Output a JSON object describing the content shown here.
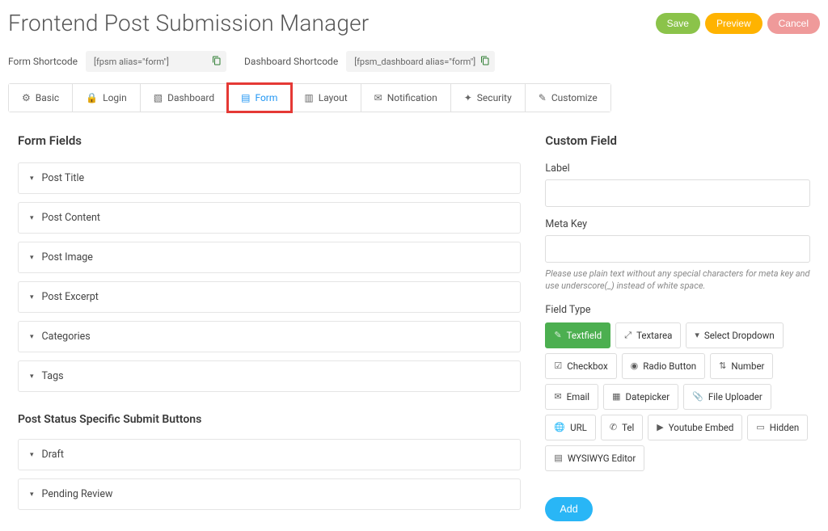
{
  "header": {
    "title": "Frontend Post Submission Manager",
    "buttons": {
      "save": "Save",
      "preview": "Preview",
      "cancel": "Cancel"
    }
  },
  "shortcodes": {
    "form_label": "Form Shortcode",
    "form_value": "[fpsm alias=\"form\"]",
    "dash_label": "Dashboard Shortcode",
    "dash_value": "[fpsm_dashboard alias=\"form\"]"
  },
  "tabs": [
    {
      "icon": "gear-icon",
      "glyph": "⚙",
      "label": "Basic"
    },
    {
      "icon": "lock-icon",
      "glyph": "🔒",
      "label": "Login"
    },
    {
      "icon": "dashboard-icon",
      "glyph": "▧",
      "label": "Dashboard"
    },
    {
      "icon": "form-icon",
      "glyph": "▤",
      "label": "Form",
      "active": true,
      "highlighted": true
    },
    {
      "icon": "layout-icon",
      "glyph": "▥",
      "label": "Layout"
    },
    {
      "icon": "mail-icon",
      "glyph": "✉",
      "label": "Notification"
    },
    {
      "icon": "shield-icon",
      "glyph": "✦",
      "label": "Security"
    },
    {
      "icon": "brush-icon",
      "glyph": "✎",
      "label": "Customize"
    }
  ],
  "form_fields": {
    "title": "Form Fields",
    "items": [
      "Post Title",
      "Post Content",
      "Post Image",
      "Post Excerpt",
      "Categories",
      "Tags"
    ]
  },
  "status_buttons": {
    "title": "Post Status Specific Submit Buttons",
    "items": [
      "Draft",
      "Pending Review"
    ]
  },
  "custom_field": {
    "title": "Custom Field",
    "label_label": "Label",
    "metakey_label": "Meta Key",
    "metakey_hint": "Please use plain text without any special characters for meta key and use underscore(_) instead of white space.",
    "fieldtype_label": "Field Type",
    "types": [
      {
        "icon": "✎",
        "label": "Textfield",
        "active": true
      },
      {
        "icon": "⤢",
        "label": "Textarea"
      },
      {
        "icon": "▾",
        "label": "Select Dropdown"
      },
      {
        "icon": "☑",
        "label": "Checkbox"
      },
      {
        "icon": "◉",
        "label": "Radio Button"
      },
      {
        "icon": "⇅",
        "label": "Number"
      },
      {
        "icon": "✉",
        "label": "Email"
      },
      {
        "icon": "▦",
        "label": "Datepicker"
      },
      {
        "icon": "📎",
        "label": "File Uploader"
      },
      {
        "icon": "🌐",
        "label": "URL"
      },
      {
        "icon": "✆",
        "label": "Tel"
      },
      {
        "icon": "▶",
        "label": "Youtube Embed"
      },
      {
        "icon": "▭",
        "label": "Hidden"
      },
      {
        "icon": "▤",
        "label": "WYSIWYG Editor"
      }
    ],
    "add_label": "Add"
  }
}
